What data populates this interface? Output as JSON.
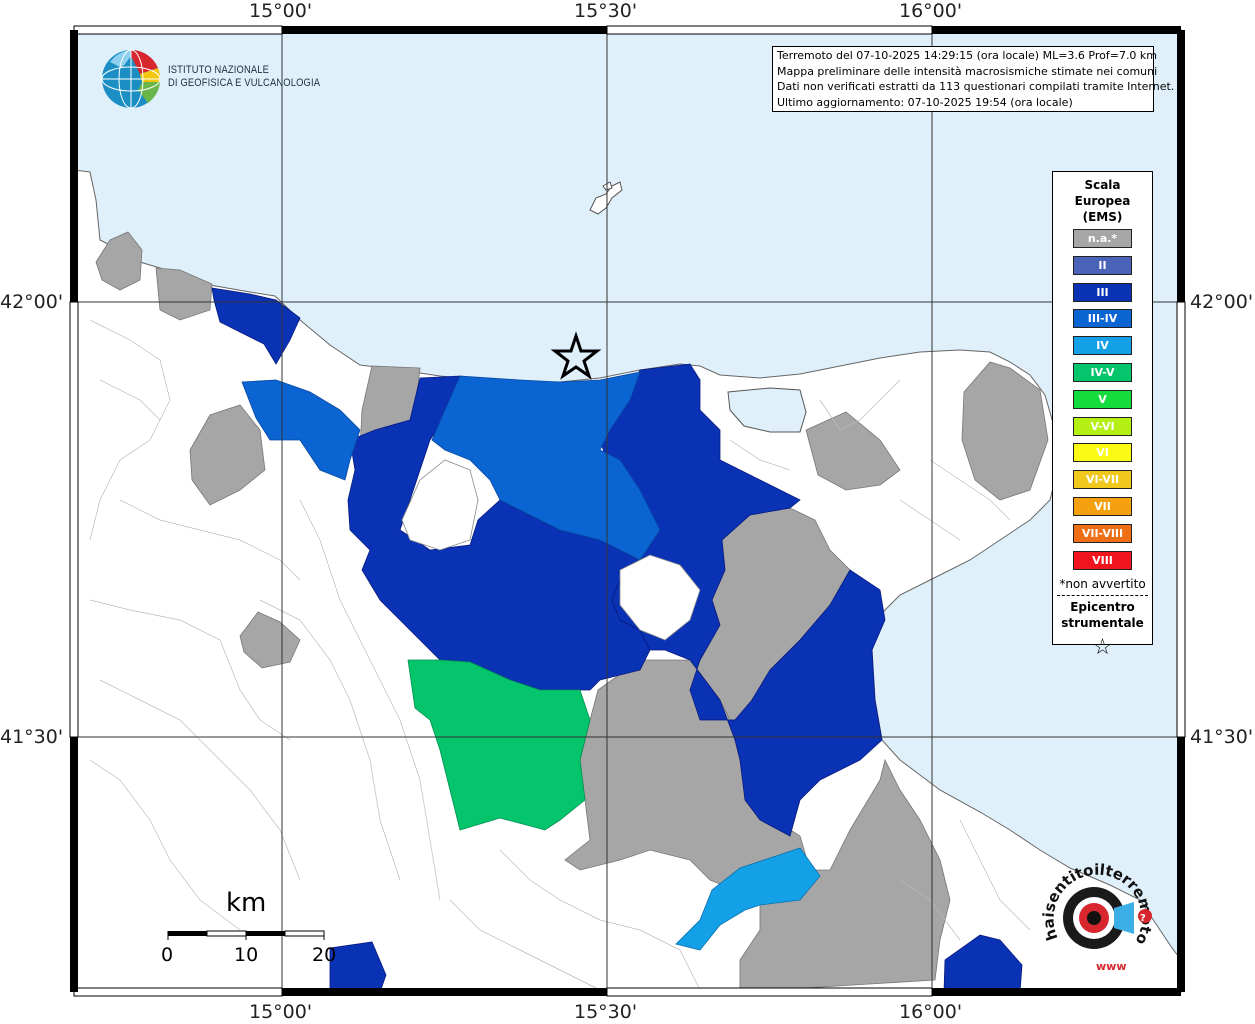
{
  "coords": {
    "lon_top": [
      "15°00'",
      "15°30'",
      "16°00'"
    ],
    "lon_bottom": [
      "15°00'",
      "15°30'",
      "16°00'"
    ],
    "lat_left": [
      "42°00'",
      "41°30'"
    ],
    "lat_right": [
      "42°00'",
      "41°30'"
    ]
  },
  "info": {
    "line1": "Terremoto del 07-10-2025 14:29:15 (ora locale) ML=3.6 Prof=7.0 km",
    "line2": "Mappa preliminare delle intensità macrosismiche stimate nei comuni",
    "line3": "Dati non verificati estratti da 113 questionari compilati tramite Internet.",
    "line4": "Ultimo aggiornamento: 07-10-2025 19:54 (ora locale)"
  },
  "institute": {
    "line1": "ISTITUTO NAZIONALE",
    "line2": "DI GEOFISICA E VULCANOLOGIA"
  },
  "legend": {
    "title1": "Scala",
    "title2": "Europea",
    "title3": "(EMS)",
    "items": [
      {
        "label": "n.a.*",
        "color": "#a6a6a6"
      },
      {
        "label": "II",
        "color": "#4a62b8"
      },
      {
        "label": "III",
        "color": "#0a32b4"
      },
      {
        "label": "III-IV",
        "color": "#0a64d2"
      },
      {
        "label": "IV",
        "color": "#14a0e6"
      },
      {
        "label": "IV-V",
        "color": "#04c46c"
      },
      {
        "label": "V",
        "color": "#14dc3c"
      },
      {
        "label": "V-VI",
        "color": "#b4f014"
      },
      {
        "label": "VI",
        "color": "#fafa14"
      },
      {
        "label": "VI-VII",
        "color": "#f0c81e"
      },
      {
        "label": "VII",
        "color": "#f5a00f"
      },
      {
        "label": "VII-VIII",
        "color": "#f06e14"
      },
      {
        "label": "VIII",
        "color": "#f0141e"
      }
    ],
    "note": "*non avvertito",
    "epicenter1": "Epicentro",
    "epicenter2": "strumentale",
    "star": "☆"
  },
  "scale_bar": {
    "unit": "km",
    "labels": [
      "0",
      "10",
      "20"
    ]
  },
  "logo2": {
    "text": "haisentitoilterremoto.it",
    "url": "www"
  },
  "colors": {
    "sea": "#dff0fb",
    "land": "#ffffff",
    "na": "#a6a6a6",
    "iii": "#0a32b4",
    "iii_iv": "#0a64d2",
    "iv": "#14a0e6",
    "iv_v": "#04c46c"
  }
}
